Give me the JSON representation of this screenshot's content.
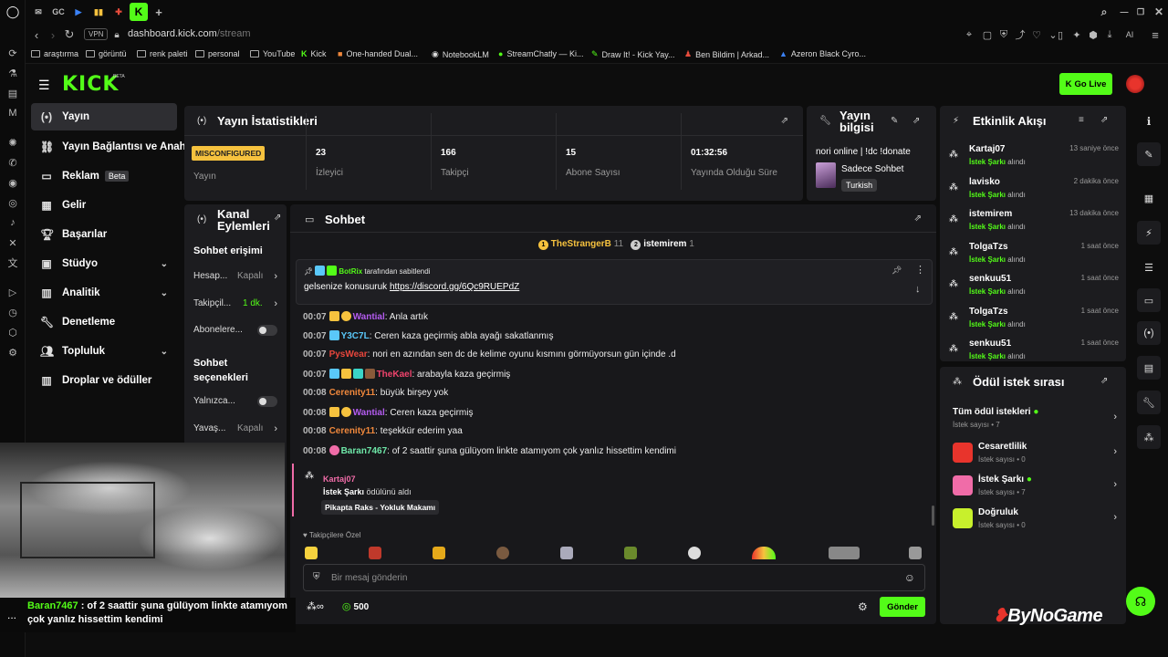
{
  "browser": {
    "address": {
      "vpn": "VPN",
      "url_host": "dashboard.kick.com",
      "url_path": "/stream"
    },
    "tabs": [
      "GC"
    ],
    "bookmarks": [
      "araştırma",
      "görüntü",
      "renk paleti",
      "personal",
      "YouTube",
      "Kick",
      "One-handed Dual...",
      "NotebookLM",
      "StreamChatly — Ki...",
      "Draw It! - Kick Yay...",
      "Ben Bildim | Arkad...",
      "Azeron Black Cyro..."
    ],
    "ai_label": "AI"
  },
  "header": {
    "logo": "KICK",
    "logo_tag": "BETA",
    "go_live": "Go Live"
  },
  "sidebar": {
    "items": [
      {
        "label": "Yayın",
        "icon": "(•)"
      },
      {
        "label": "Yayın Bağlantısı ve Anahtarı",
        "icon": "link"
      },
      {
        "label": "Reklam",
        "icon": "ad",
        "badge": "Beta"
      },
      {
        "label": "Gelir",
        "icon": "chart"
      },
      {
        "label": "Başarılar",
        "icon": "trophy"
      },
      {
        "label": "Stüdyo",
        "icon": "studio"
      },
      {
        "label": "Analitik",
        "icon": "analytics"
      },
      {
        "label": "Denetleme",
        "icon": "wrench"
      },
      {
        "label": "Topluluk",
        "icon": "users"
      },
      {
        "label": "Droplar ve ödüller",
        "icon": "gift"
      }
    ]
  },
  "stats": {
    "title": "Yayın İstatistikleri",
    "status": "MISCONFIGURED",
    "status_label": "Yayın",
    "items": [
      {
        "value": "23",
        "label": "İzleyici"
      },
      {
        "value": "166",
        "label": "Takipçi"
      },
      {
        "value": "15",
        "label": "Abone Sayısı"
      },
      {
        "value": "01:32:56",
        "label": "Yayında Olduğu Süre"
      }
    ]
  },
  "stream_info": {
    "title": "Yayın bilgisi",
    "stream_title": "nori online | !dc !donate",
    "category": "Sadece Sohbet",
    "language": "Turkish"
  },
  "channel_actions": {
    "title": "Kanal Eylemleri",
    "section1": "Sohbet erişimi",
    "rows1": [
      {
        "label": "Hesap...",
        "value": "Kapalı"
      },
      {
        "label": "Takipçil...",
        "value": "1 dk."
      },
      {
        "label": "Abonelere..."
      }
    ],
    "section2": "Sohbet seçenekleri",
    "rows2": [
      {
        "label": "Yalnızca..."
      },
      {
        "label": "Yavaş...",
        "value": "Kapalı"
      }
    ]
  },
  "chat": {
    "title": "Sohbet",
    "top": [
      {
        "rank": "1",
        "name": "TheStrangerB",
        "count": "11"
      },
      {
        "rank": "2",
        "name": "istemirem",
        "count": "1"
      }
    ],
    "pinned": {
      "by_user": "BotRix",
      "by_text": "tarafından sabitlendi",
      "text": "gelsenize konusuruk ",
      "link": "https://discord.gg/6Qc9RUEPdZ"
    },
    "messages": [
      {
        "time": "00:07",
        "user": "Wantial",
        "color": "#b45cf0",
        "text": ": Anla artık"
      },
      {
        "time": "00:07",
        "user": "Y3C7L",
        "color": "#5ac8fa",
        "text": ": Ceren kaza geçirmiş abla ayağı sakatlanmış"
      },
      {
        "time": "00:07",
        "user": "PysWear",
        "color": "#e8463c",
        "text": ": nori en azından sen dc de kelime oyunu kısmını görmüyorsun gün içinde .d"
      },
      {
        "time": "00:07",
        "user": "TheKael",
        "color": "#f0436c",
        "text": ": arabayla kaza geçirmiş"
      },
      {
        "time": "00:08",
        "user": "Cerenity11",
        "color": "#f0883c",
        "text": ": büyük birşey yok"
      },
      {
        "time": "00:08",
        "user": "Wantial",
        "color": "#b45cf0",
        "text": ": Ceren kaza geçirmiş"
      },
      {
        "time": "00:08",
        "user": "Cerenity11",
        "color": "#f0883c",
        "text": ": teşekkür ederim yaa"
      },
      {
        "time": "00:08",
        "user": "Baran7467",
        "color": "#6ee7a8",
        "text": ": of 2 saattir şuna gülüyom linkte atamıyom çok yanlız hissettim kendimi"
      }
    ],
    "reward": {
      "user": "Kartaj07",
      "reward": "İstek Şarkı",
      "action": "ödülünü aldı",
      "song": "Pikapta Raks - Yokluk Makamı"
    },
    "followers_only": "Takipçilere Özel",
    "placeholder": "Bir mesaj gönderin",
    "points": "500",
    "infinity": "∞",
    "send": "Gönder"
  },
  "activity": {
    "title": "Etkinlik Akışı",
    "items": [
      {
        "user": "Kartaj07",
        "reward": "İstek Şarkı",
        "action": "alındı",
        "time": "13 saniye önce"
      },
      {
        "user": "lavisko",
        "reward": "İstek Şarkı",
        "action": "alındı",
        "time": "2 dakika önce"
      },
      {
        "user": "istemirem",
        "reward": "İstek Şarkı",
        "action": "alındı",
        "time": "13 dakika önce"
      },
      {
        "user": "TolgaTzs",
        "reward": "İstek Şarkı",
        "action": "alındı",
        "time": "1 saat önce"
      },
      {
        "user": "senkuu51",
        "reward": "İstek Şarkı",
        "action": "alındı",
        "time": "1 saat önce"
      },
      {
        "user": "TolgaTzs",
        "reward": "İstek Şarkı",
        "action": "alındı",
        "time": "1 saat önce"
      },
      {
        "user": "senkuu51",
        "reward": "İstek Şarkı",
        "action": "alındı",
        "time": "1 saat önce"
      }
    ]
  },
  "reward_queue": {
    "title": "Ödül istek sırası",
    "all": {
      "label": "Tüm ödül istekleri",
      "count": "İstek sayısı • 7"
    },
    "items": [
      {
        "name": "Cesaretlilik",
        "count": "İstek sayısı • 0",
        "color": "#e8342c"
      },
      {
        "name": "İstek Şarkı",
        "count": "İstek sayısı • 7",
        "color": "#f06ca8"
      },
      {
        "name": "Doğruluk",
        "count": "İstek sayısı • 0",
        "color": "#c8f02c"
      }
    ]
  },
  "overlay": {
    "name": "Baran7467",
    "text": " : of 2 saattir şuna gülüyom linkte atamıyom çok yanlız hissettim kendimi",
    "more": "..."
  },
  "watermark": "ByNoGame",
  "colors": {
    "accent": "#53fc18",
    "card": "#1c1c1f",
    "bg": "#0d0d0d",
    "badge": "#f6c23e"
  }
}
